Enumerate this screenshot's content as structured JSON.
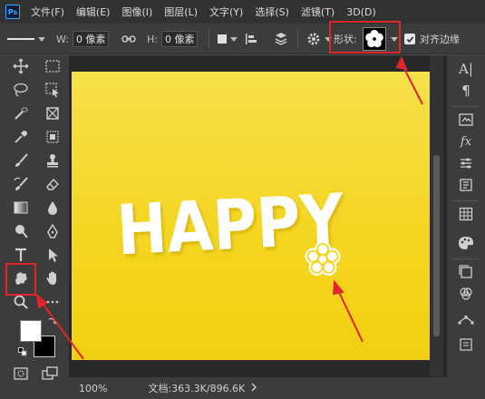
{
  "app": {
    "logo_text": "Ps"
  },
  "menu": {
    "items": [
      "文件(F)",
      "编辑(E)",
      "图像(I)",
      "图层(L)",
      "文字(Y)",
      "选择(S)",
      "滤镜(T)",
      "3D(D)"
    ]
  },
  "options": {
    "w_label": "W:",
    "w_value": "0 像素",
    "h_label": "H:",
    "h_value": "0 像素",
    "shape_label": "形状:",
    "align_edges_label": "对齐边缘",
    "align_edges_checked": true
  },
  "canvas": {
    "text": "HAPPY",
    "background_color": "#f4d51f"
  },
  "status": {
    "zoom": "100%",
    "doc_info": "文档:363.3K/896.6K"
  },
  "colors": {
    "highlight": "#e0262b",
    "foreground": "#ffffff",
    "background": "#000000"
  }
}
